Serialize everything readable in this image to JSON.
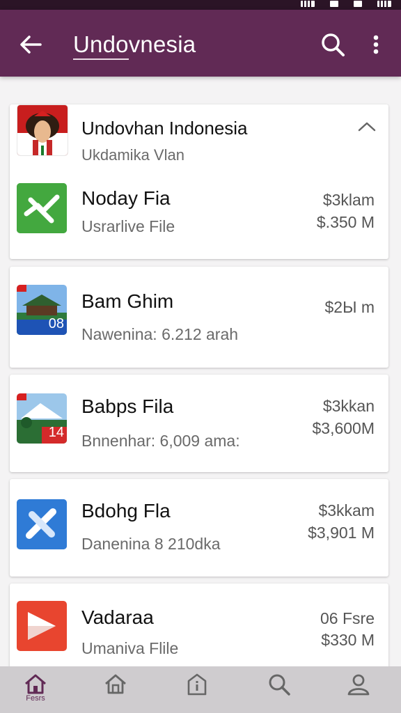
{
  "appbar": {
    "title": "Undovnesia",
    "back_icon": "arrow-left-icon",
    "search_icon": "search-icon",
    "more_icon": "more-vert-icon",
    "color": "#612a55"
  },
  "list": {
    "header": {
      "title": "Undovhan Indonesia",
      "subtitle": "Ukdamika Vlan",
      "icon": "chevron-up-icon"
    },
    "items": [
      {
        "title": "Noday Fia",
        "subtitle": "Usrarlive File",
        "price_top": "$3klam",
        "price_bottom": "$.350 M",
        "thumb": "green-app-icon"
      },
      {
        "title": "Bam Ghim",
        "subtitle": "Nawenina: 6.212 arah",
        "price_top": "$2Ы m",
        "price_bottom": "",
        "thumb": "pavilion-photo",
        "thumb_badge": "08"
      },
      {
        "title": "Babps Fila",
        "subtitle": "Bnnenhar: 6,009 ama:",
        "price_top": "$3kkan",
        "price_bottom": "$3,600M",
        "thumb": "tent-photo",
        "thumb_badge": "14"
      },
      {
        "title": "Bdohg Fla",
        "subtitle": "Danenina 8 210dka",
        "price_top": "$3kkam",
        "price_bottom": "$3,901 M",
        "thumb": "blue-x-app-icon"
      },
      {
        "title": "Vadaraa",
        "subtitle": "Umaniva Flile",
        "price_top": "06 Fsre",
        "price_bottom": "$330 M",
        "thumb": "red-play-app-icon"
      }
    ]
  },
  "bottom_nav": {
    "items": [
      {
        "icon": "home-icon",
        "label": "Fesrs",
        "active": true
      },
      {
        "icon": "house-icon",
        "label": ""
      },
      {
        "icon": "info-house-icon",
        "label": ""
      },
      {
        "icon": "search-icon",
        "label": ""
      },
      {
        "icon": "profile-icon",
        "label": ""
      }
    ]
  }
}
